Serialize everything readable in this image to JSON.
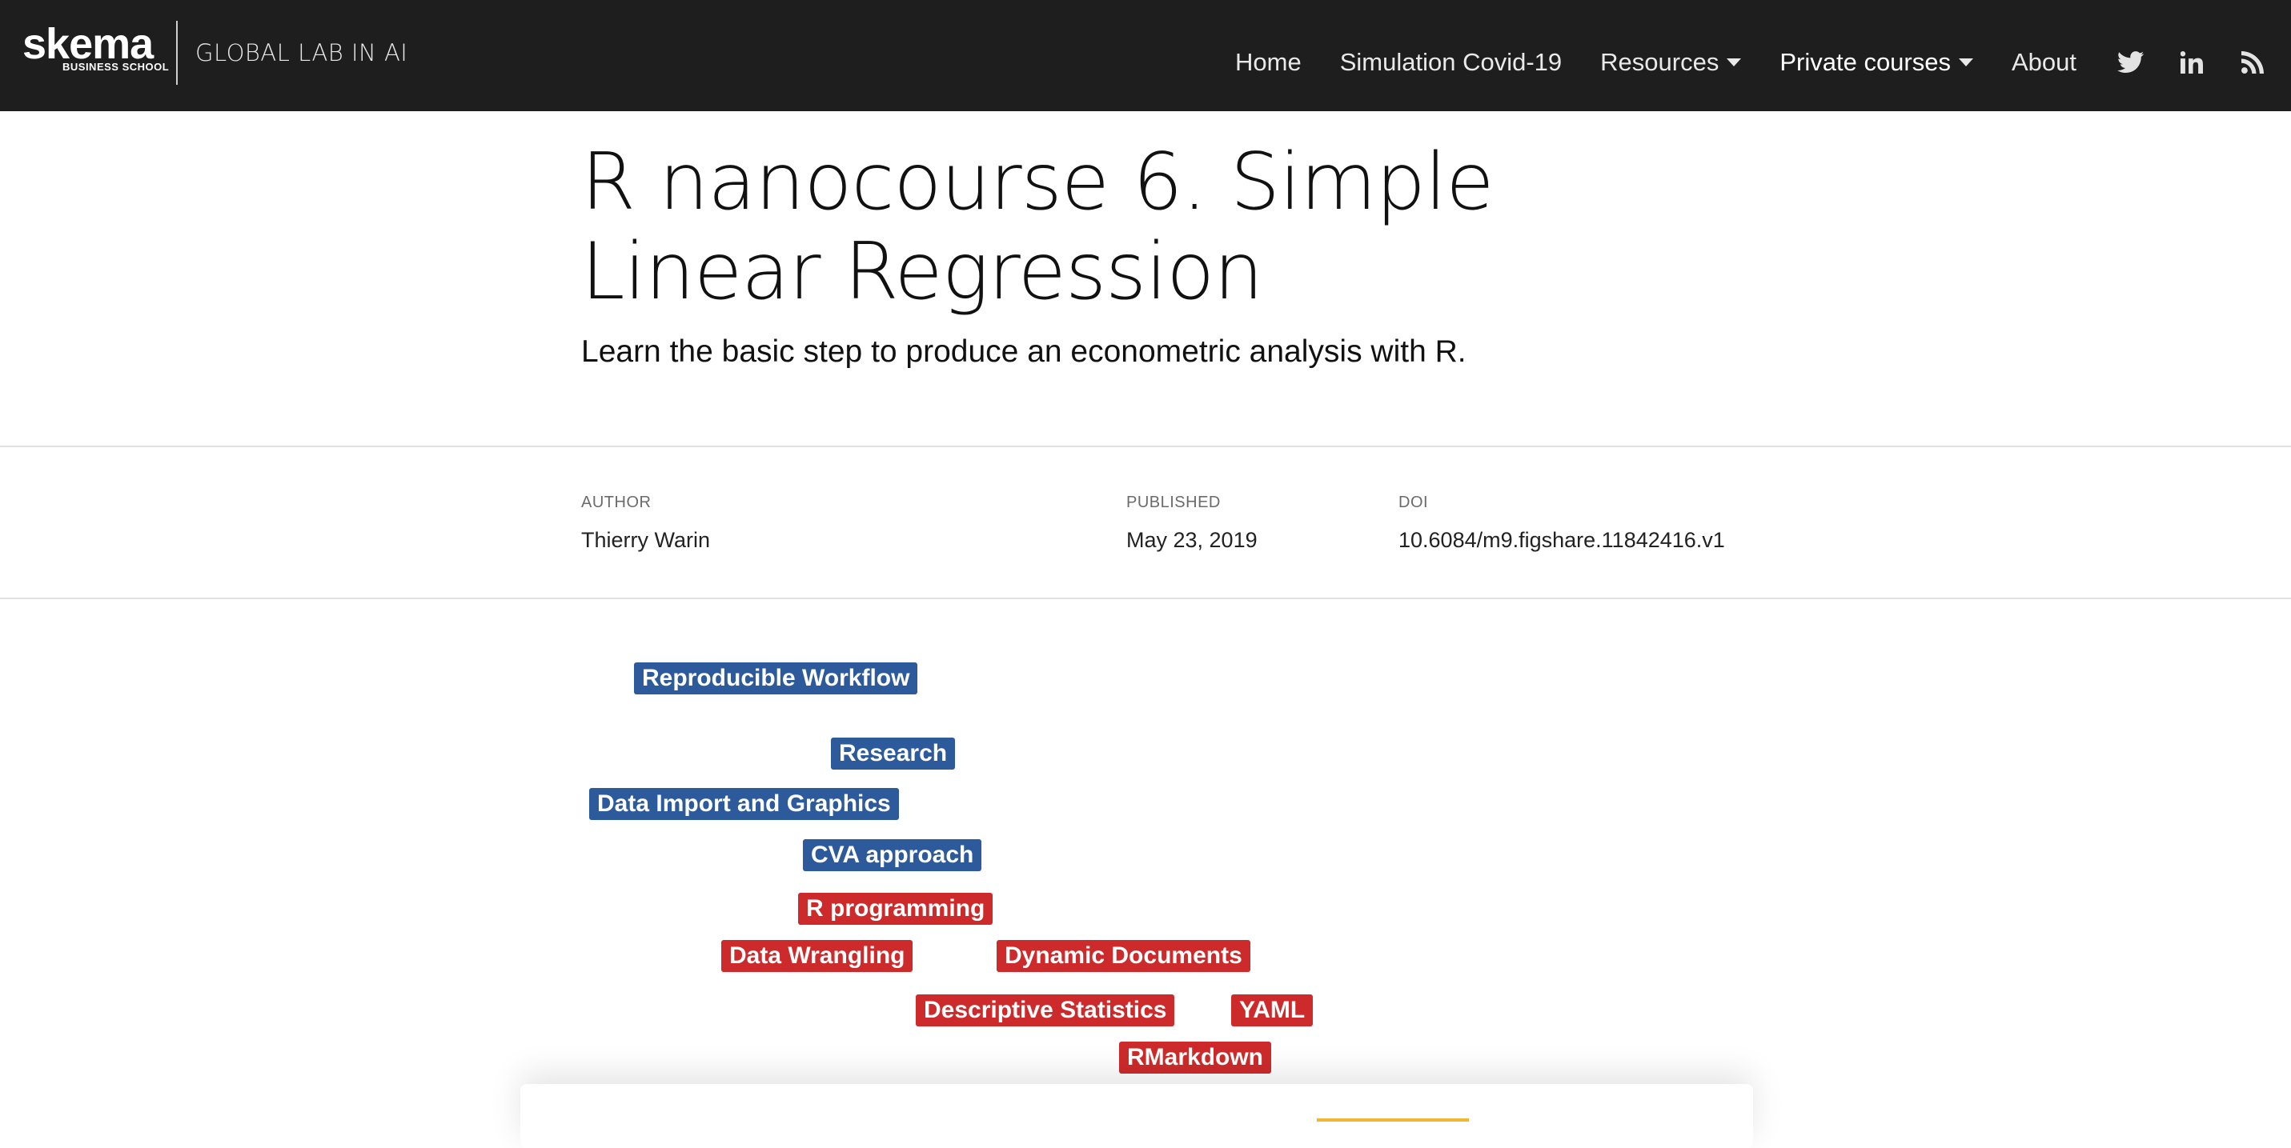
{
  "brand": {
    "logo_word": "skema",
    "logo_sub": "BUSINESS SCHOOL",
    "lab_name": "GLOBAL LAB IN AI"
  },
  "nav": {
    "items": [
      {
        "label": "Home"
      },
      {
        "label": "Simulation Covid-19"
      },
      {
        "label": "Resources"
      },
      {
        "label": "Private courses"
      },
      {
        "label": "About"
      }
    ],
    "icons": [
      "twitter-icon",
      "linkedin-icon",
      "rss-icon"
    ]
  },
  "article": {
    "title": "R nanocourse 6. Simple Linear Regression",
    "subtitle": "Learn the basic step to produce an econometric analysis with R."
  },
  "meta": {
    "author_label": "AUTHOR",
    "author": "Thierry Warin",
    "published_label": "PUBLISHED",
    "published": "May 23, 2019",
    "doi_label": "DOI",
    "doi": "10.6084/m9.figshare.11842416.v1"
  },
  "tags": [
    {
      "label": "Reproducible Workflow",
      "color": "#2d5a9b"
    },
    {
      "label": "Research",
      "color": "#2d5a9b"
    },
    {
      "label": "Data Import and Graphics",
      "color": "#2d5a9b"
    },
    {
      "label": "CVA approach",
      "color": "#2d5a9b"
    },
    {
      "label": "R programming",
      "color": "#cd2b2b"
    },
    {
      "label": "Data Wrangling",
      "color": "#cd2b2b"
    },
    {
      "label": "Dynamic Documents",
      "color": "#cd2b2b"
    },
    {
      "label": "Descriptive Statistics",
      "color": "#cd2b2b"
    },
    {
      "label": "YAML",
      "color": "#cd2b2b"
    },
    {
      "label": "RMarkdown",
      "color": "#cd2b2b"
    }
  ],
  "colors": {
    "navbar": "#1e1e1e",
    "accent": "#f2b632"
  }
}
